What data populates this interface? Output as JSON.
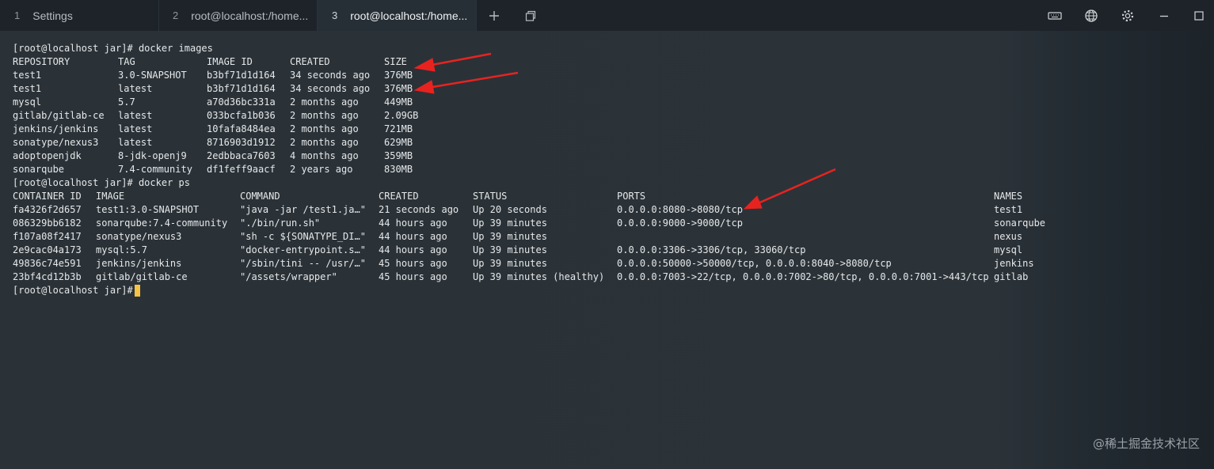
{
  "tabs": [
    {
      "num": "1",
      "label": "Settings"
    },
    {
      "num": "2",
      "label": "root@localhost:/home..."
    },
    {
      "num": "3",
      "label": "root@localhost:/home..."
    }
  ],
  "toolbar": {
    "new_tab": "new-tab-icon",
    "duplicate": "duplicate-window-icon",
    "keyboard": "keyboard-icon",
    "globe": "globe-icon",
    "settings": "gear-icon",
    "minimize": "minimize-icon",
    "maximize": "maximize-icon"
  },
  "terminal": {
    "cmd1": "[root@localhost jar]# docker images",
    "images_headers": [
      "REPOSITORY",
      "TAG",
      "IMAGE ID",
      "CREATED",
      "SIZE"
    ],
    "images": [
      [
        "test1",
        "3.0-SNAPSHOT",
        "b3bf71d1d164",
        "34 seconds ago",
        "376MB"
      ],
      [
        "test1",
        "latest",
        "b3bf71d1d164",
        "34 seconds ago",
        "376MB"
      ],
      [
        "mysql",
        "5.7",
        "a70d36bc331a",
        "2 months ago",
        "449MB"
      ],
      [
        "gitlab/gitlab-ce",
        "latest",
        "033bcfa1b036",
        "2 months ago",
        "2.09GB"
      ],
      [
        "jenkins/jenkins",
        "latest",
        "10fafa8484ea",
        "2 months ago",
        "721MB"
      ],
      [
        "sonatype/nexus3",
        "latest",
        "8716903d1912",
        "2 months ago",
        "629MB"
      ],
      [
        "adoptopenjdk",
        "8-jdk-openj9",
        "2edbbaca7603",
        "4 months ago",
        "359MB"
      ],
      [
        "sonarqube",
        "7.4-community",
        "df1feff9aacf",
        "2 years ago",
        "830MB"
      ]
    ],
    "cmd2": "[root@localhost jar]# docker ps",
    "ps_headers": [
      "CONTAINER ID",
      "IMAGE",
      "COMMAND",
      "CREATED",
      "STATUS",
      "PORTS",
      "NAMES"
    ],
    "containers": [
      [
        "fa4326f2d657",
        "test1:3.0-SNAPSHOT",
        "\"java -jar /test1.ja…\"",
        "21 seconds ago",
        "Up 20 seconds",
        "0.0.0.0:8080->8080/tcp",
        "test1"
      ],
      [
        "086329bb6182",
        "sonarqube:7.4-community",
        "\"./bin/run.sh\"",
        "44 hours ago",
        "Up 39 minutes",
        "0.0.0.0:9000->9000/tcp",
        "sonarqube"
      ],
      [
        "f107a08f2417",
        "sonatype/nexus3",
        "\"sh -c ${SONATYPE_DI…\"",
        "44 hours ago",
        "Up 39 minutes",
        "",
        "nexus"
      ],
      [
        "2e9cac04a173",
        "mysql:5.7",
        "\"docker-entrypoint.s…\"",
        "44 hours ago",
        "Up 39 minutes",
        "0.0.0.0:3306->3306/tcp, 33060/tcp",
        "mysql"
      ],
      [
        "49836c74e591",
        "jenkins/jenkins",
        "\"/sbin/tini -- /usr/…\"",
        "45 hours ago",
        "Up 39 minutes",
        "0.0.0.0:50000->50000/tcp, 0.0.0.0:8040->8080/tcp",
        "jenkins"
      ],
      [
        "23bf4cd12b3b",
        "gitlab/gitlab-ce",
        "\"/assets/wrapper\"",
        "45 hours ago",
        "Up 39 minutes (healthy)",
        "0.0.0.0:7003->22/tcp, 0.0.0.0:7002->80/tcp, 0.0.0.0:7001->443/tcp",
        "gitlab"
      ]
    ],
    "prompt": "[root@localhost jar]#"
  },
  "colors": {
    "cursor": "#f6c343",
    "arrow": "#e8231f"
  },
  "watermark": "@稀土掘金技术社区"
}
